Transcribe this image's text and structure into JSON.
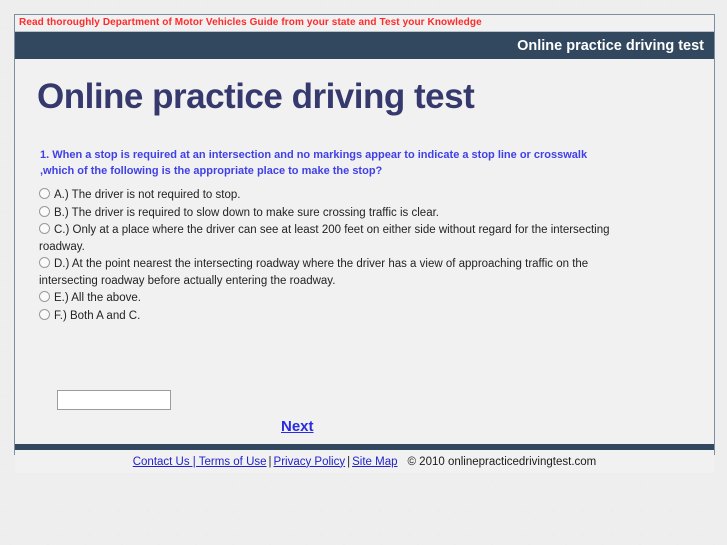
{
  "notice": {
    "text": "Read thoroughly Department of Motor Vehicles Guide from your state and Test your Knowledge",
    "color": "#ff2a2a"
  },
  "header": {
    "title": "Online practice driving test",
    "bg_color": "#31485f",
    "text_color": "#ffffff"
  },
  "main": {
    "page_title": "Online practice driving test",
    "page_title_color": "#36396d",
    "question": {
      "number": "1.",
      "line1": "1. When a stop is required at an intersection and no markings appear to indicate a stop line or crosswalk",
      "line2": ",which of the following is the appropriate place to make the stop?",
      "color": "#4040e8"
    },
    "options": [
      {
        "id": "A",
        "label": "A.) The driver is not required to stop.",
        "selected": false
      },
      {
        "id": "B",
        "label": "B.) The driver is required to slow down to make sure crossing traffic is clear.",
        "selected": false
      },
      {
        "id": "C",
        "label": "C.) Only at a place where the driver can see at least 200 feet on either side without regard for the intersecting roadway.",
        "selected": false
      },
      {
        "id": "D",
        "label": "D.) At the point nearest the intersecting roadway where the driver has a view of approaching traffic on the intersecting roadway before actually entering the roadway.",
        "selected": false
      },
      {
        "id": "E",
        "label": "E.) All the above.",
        "selected": false
      },
      {
        "id": "F",
        "label": "F.) Both A and C.",
        "selected": false
      }
    ],
    "answer_input": {
      "value": "",
      "placeholder": ""
    },
    "next_label": "Next"
  },
  "footer": {
    "links": [
      {
        "label": "Contact Us | Terms of Use"
      },
      {
        "label": "Privacy Policy"
      },
      {
        "label": "Site Map"
      }
    ],
    "separator": "|",
    "copyright": "© 2010 onlinepracticedrivingtest.com"
  }
}
